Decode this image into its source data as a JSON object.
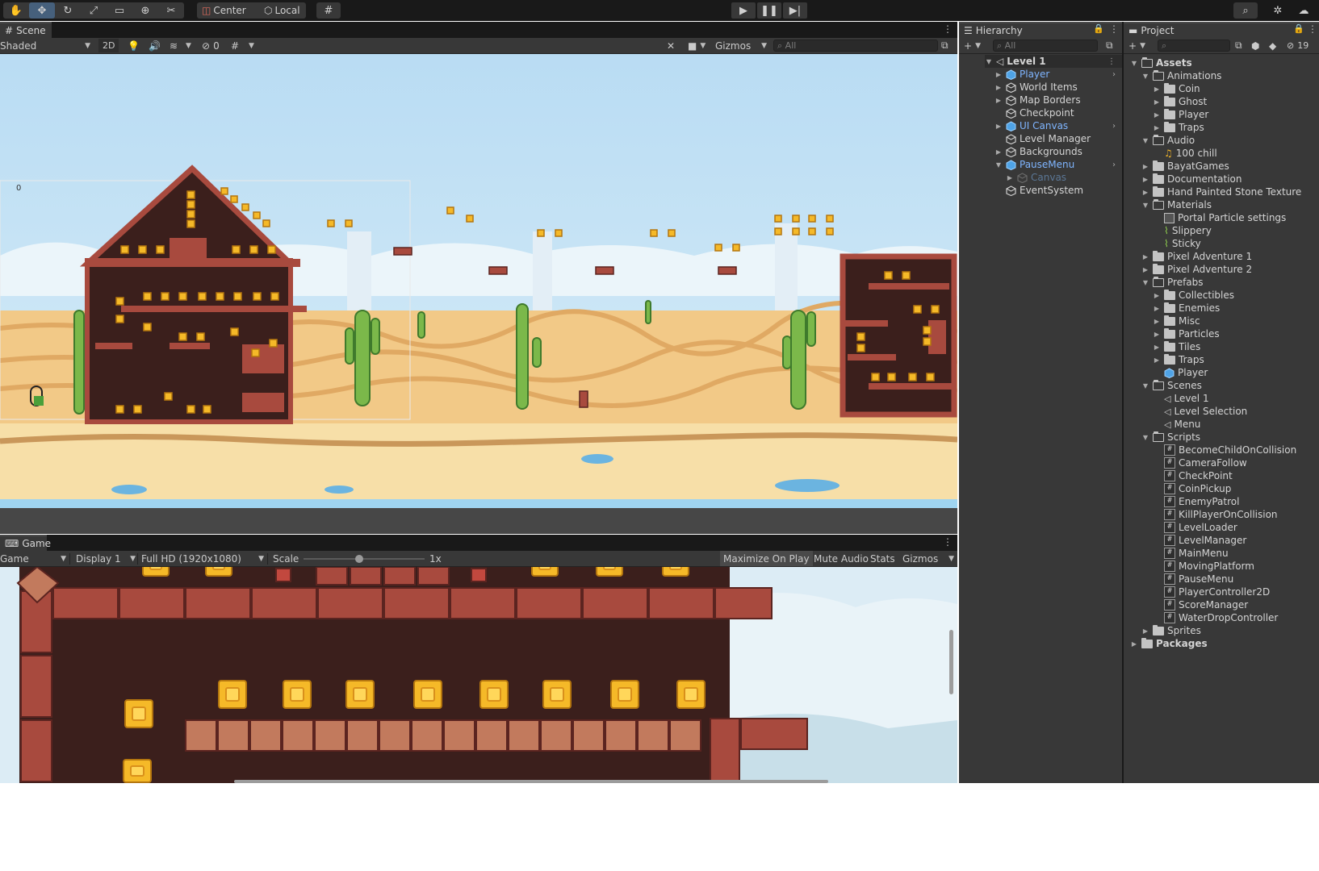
{
  "toolbar": {
    "tools": [
      "hand-icon",
      "move-icon",
      "rotate-icon",
      "scale-icon",
      "rect-icon",
      "transform-icon",
      "custom-tool-icon"
    ],
    "pivot_label": "Center",
    "space_label": "Local"
  },
  "scene": {
    "tab_label": "Scene",
    "shading_mode": "Shaded",
    "mode_2d": "2D",
    "hidden_count": "0",
    "gizmos_label": "Gizmos",
    "search_placeholder": "All",
    "camera_label": "0"
  },
  "game": {
    "tab_label": "Game",
    "view_mode": "Game",
    "display": "Display 1",
    "resolution": "Full HD (1920x1080)",
    "scale_label": "Scale",
    "scale_value": "1x",
    "maximize_label": "Maximize On Play",
    "mute_label": "Mute Audio",
    "stats_label": "Stats",
    "gizmos_label": "Gizmos"
  },
  "hierarchy": {
    "tab_label": "Hierarchy",
    "search_placeholder": "All",
    "root": "Level 1",
    "items": [
      {
        "label": "Player",
        "prefab": true,
        "arrow": "▶",
        "chevron": true
      },
      {
        "label": "World Items",
        "prefab": false,
        "arrow": "▶",
        "chevron": false
      },
      {
        "label": "Map Borders",
        "prefab": false,
        "arrow": "▶",
        "chevron": false
      },
      {
        "label": "Checkpoint",
        "prefab": false,
        "arrow": "",
        "chevron": false
      },
      {
        "label": "UI Canvas",
        "prefab": true,
        "arrow": "▶",
        "chevron": true
      },
      {
        "label": "Level Manager",
        "prefab": false,
        "arrow": "",
        "chevron": false
      },
      {
        "label": "Backgrounds",
        "prefab": false,
        "arrow": "▶",
        "chevron": false
      },
      {
        "label": "PauseMenu",
        "prefab": true,
        "arrow": "▼",
        "chevron": true
      },
      {
        "label": "Canvas",
        "prefab": false,
        "arrow": "▶",
        "chevron": false,
        "disabled": true,
        "indent": 1
      },
      {
        "label": "EventSystem",
        "prefab": false,
        "arrow": "",
        "chevron": false
      }
    ]
  },
  "project": {
    "tab_label": "Project",
    "hidden_count": "19",
    "items": [
      {
        "label": "Assets",
        "depth": 0,
        "type": "folder-open",
        "arrow": "▼",
        "bold": true
      },
      {
        "label": "Animations",
        "depth": 1,
        "type": "folder-open",
        "arrow": "▼"
      },
      {
        "label": "Coin",
        "depth": 2,
        "type": "folder",
        "arrow": "▶"
      },
      {
        "label": "Ghost",
        "depth": 2,
        "type": "folder",
        "arrow": "▶"
      },
      {
        "label": "Player",
        "depth": 2,
        "type": "folder",
        "arrow": "▶"
      },
      {
        "label": "Traps",
        "depth": 2,
        "type": "folder",
        "arrow": "▶"
      },
      {
        "label": "Audio",
        "depth": 1,
        "type": "folder-open",
        "arrow": "▼"
      },
      {
        "label": "100 chill",
        "depth": 2,
        "type": "audio",
        "arrow": ""
      },
      {
        "label": "BayatGames",
        "depth": 1,
        "type": "folder",
        "arrow": "▶"
      },
      {
        "label": "Documentation",
        "depth": 1,
        "type": "folder",
        "arrow": "▶"
      },
      {
        "label": "Hand Painted Stone Texture",
        "depth": 1,
        "type": "folder",
        "arrow": "▶"
      },
      {
        "label": "Materials",
        "depth": 1,
        "type": "folder-open",
        "arrow": "▼"
      },
      {
        "label": "Portal Particle settings",
        "depth": 2,
        "type": "material",
        "arrow": ""
      },
      {
        "label": "Slippery",
        "depth": 2,
        "type": "physics",
        "arrow": ""
      },
      {
        "label": "Sticky",
        "depth": 2,
        "type": "physics",
        "arrow": ""
      },
      {
        "label": "Pixel Adventure 1",
        "depth": 1,
        "type": "folder",
        "arrow": "▶"
      },
      {
        "label": "Pixel Adventure 2",
        "depth": 1,
        "type": "folder",
        "arrow": "▶"
      },
      {
        "label": "Prefabs",
        "depth": 1,
        "type": "folder-open",
        "arrow": "▼"
      },
      {
        "label": "Collectibles",
        "depth": 2,
        "type": "folder",
        "arrow": "▶"
      },
      {
        "label": "Enemies",
        "depth": 2,
        "type": "folder",
        "arrow": "▶"
      },
      {
        "label": "Misc",
        "depth": 2,
        "type": "folder",
        "arrow": "▶"
      },
      {
        "label": "Particles",
        "depth": 2,
        "type": "folder",
        "arrow": "▶"
      },
      {
        "label": "Tiles",
        "depth": 2,
        "type": "folder",
        "arrow": "▶"
      },
      {
        "label": "Traps",
        "depth": 2,
        "type": "folder",
        "arrow": "▶"
      },
      {
        "label": "Player",
        "depth": 2,
        "type": "prefab",
        "arrow": ""
      },
      {
        "label": "Scenes",
        "depth": 1,
        "type": "folder-open",
        "arrow": "▼"
      },
      {
        "label": "Level 1",
        "depth": 2,
        "type": "scene",
        "arrow": ""
      },
      {
        "label": "Level Selection",
        "depth": 2,
        "type": "scene",
        "arrow": ""
      },
      {
        "label": "Menu",
        "depth": 2,
        "type": "scene",
        "arrow": ""
      },
      {
        "label": "Scripts",
        "depth": 1,
        "type": "folder-open",
        "arrow": "▼"
      },
      {
        "label": "BecomeChildOnCollision",
        "depth": 2,
        "type": "script",
        "arrow": ""
      },
      {
        "label": "CameraFollow",
        "depth": 2,
        "type": "script",
        "arrow": ""
      },
      {
        "label": "CheckPoint",
        "depth": 2,
        "type": "script",
        "arrow": ""
      },
      {
        "label": "CoinPickup",
        "depth": 2,
        "type": "script",
        "arrow": ""
      },
      {
        "label": "EnemyPatrol",
        "depth": 2,
        "type": "script",
        "arrow": ""
      },
      {
        "label": "KillPlayerOnCollision",
        "depth": 2,
        "type": "script",
        "arrow": ""
      },
      {
        "label": "LevelLoader",
        "depth": 2,
        "type": "script",
        "arrow": ""
      },
      {
        "label": "LevelManager",
        "depth": 2,
        "type": "script",
        "arrow": ""
      },
      {
        "label": "MainMenu",
        "depth": 2,
        "type": "script",
        "arrow": ""
      },
      {
        "label": "MovingPlatform",
        "depth": 2,
        "type": "script",
        "arrow": ""
      },
      {
        "label": "PauseMenu",
        "depth": 2,
        "type": "script",
        "arrow": ""
      },
      {
        "label": "PlayerController2D",
        "depth": 2,
        "type": "script",
        "arrow": ""
      },
      {
        "label": "ScoreManager",
        "depth": 2,
        "type": "script",
        "arrow": ""
      },
      {
        "label": "WaterDropController",
        "depth": 2,
        "type": "script",
        "arrow": ""
      },
      {
        "label": "Sprites",
        "depth": 1,
        "type": "folder",
        "arrow": "▶"
      },
      {
        "label": "Packages",
        "depth": 0,
        "type": "folder",
        "arrow": "▶",
        "bold": true
      }
    ]
  },
  "colors": {
    "editor_bg": "#383838",
    "toolbar_bg": "#191919",
    "prefab_blue": "#7fb5ff",
    "sky": "#c6e3f5",
    "sand": "#f4d394",
    "brick": "#a84a3e",
    "coin": "#f5b928"
  }
}
